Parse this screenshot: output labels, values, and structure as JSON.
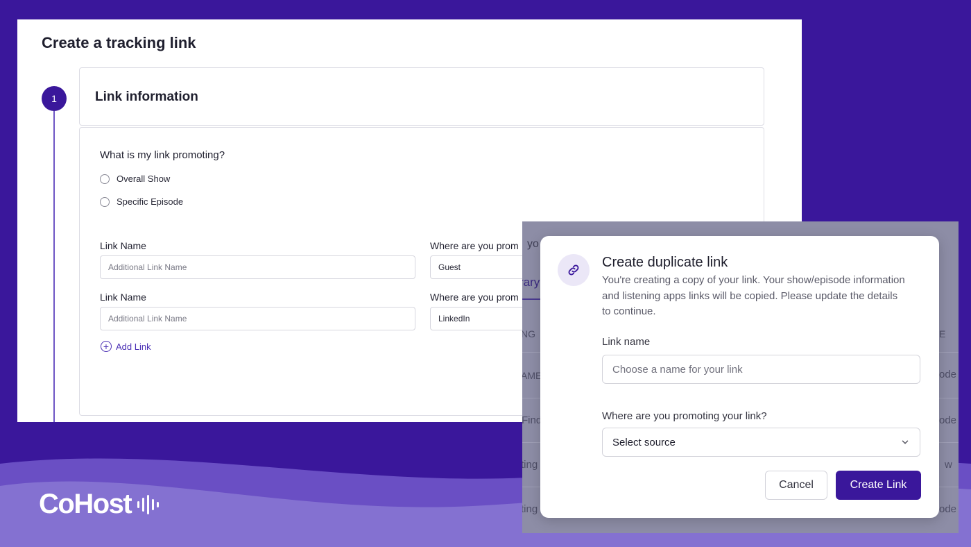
{
  "page": {
    "title": "Create a tracking link",
    "step_number": "1",
    "section_title": "Link information"
  },
  "form": {
    "question": "What is my link promoting?",
    "options": [
      "Overall Show",
      "Specific Episode"
    ],
    "rows": [
      {
        "name_label": "Link Name",
        "name_placeholder": "Additional Link Name",
        "where_label": "Where are you prom",
        "where_value": "Guest"
      },
      {
        "name_label": "Link Name",
        "name_placeholder": "Additional Link Name",
        "where_label": "Where are you prom",
        "where_value": "LinkedIn"
      }
    ],
    "add_link": "Add Link"
  },
  "background_fragments": {
    "yo": "yo",
    "tab": "rary",
    "ng": "NG",
    "e": "E",
    "ame": "AME",
    "ode1": "ode",
    "find": "Find",
    "ode2": "ode",
    "ting1": "ting",
    "w": "w",
    "ting2": "ting",
    "ode3": "ode"
  },
  "modal": {
    "title": "Create duplicate link",
    "description": "You're creating a copy of your link. Your show/episode information and listening apps links will be copied. Please update the details to continue.",
    "link_name_label": "Link name",
    "link_name_placeholder": "Choose a name for your link",
    "where_label": "Where are you promoting your link?",
    "select_value": "Select source",
    "cancel": "Cancel",
    "create": "Create Link"
  },
  "brand": {
    "logo_text": "CoHost"
  },
  "colors": {
    "brand_purple": "#3a179b",
    "wave_light": "#8471d1",
    "accent_link": "#4a2fb4"
  }
}
